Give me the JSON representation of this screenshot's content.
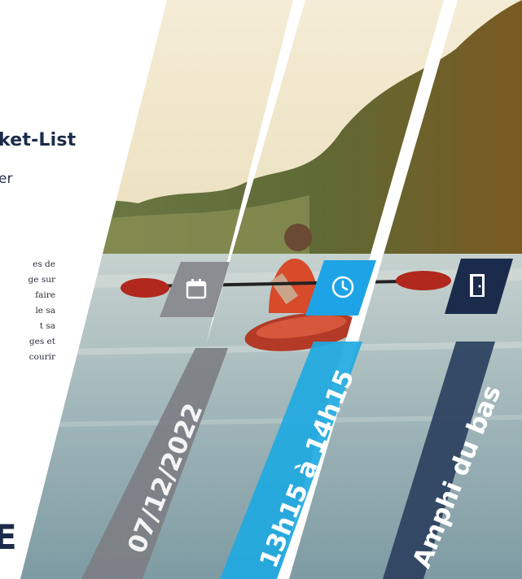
{
  "poster": {
    "top_glyph": "",
    "title": "ket-List",
    "subtitle": "er",
    "paragraph_lines": [
      "es de",
      "ge sur",
      "faire",
      "le sa",
      "t sa",
      "ges et",
      "courir"
    ],
    "footer_letter": "E"
  },
  "info": {
    "date": "07/12/2022",
    "time": "13h15 à 14h15",
    "room": "Amphi du bas"
  },
  "icons": {
    "date_icon": "calendar-icon",
    "time_icon": "clock-icon",
    "room_icon": "door-icon"
  },
  "colors": {
    "navy": "#1c2b4a",
    "gray_band": "#7d7f84",
    "blue_band": "#1fa9e1",
    "slate_band": "#2e4361",
    "calendar_box": "#8b8d92",
    "clock_box": "#1ea4e6",
    "door_box": "#1a2b4c"
  }
}
